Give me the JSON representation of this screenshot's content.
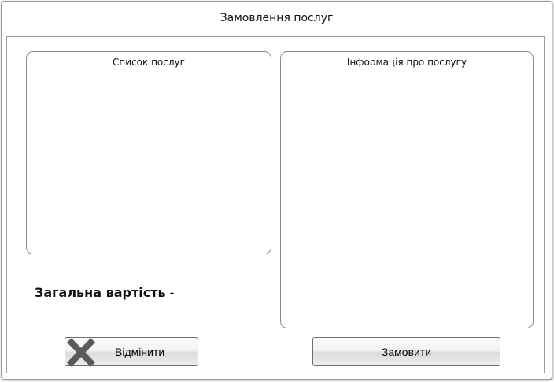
{
  "window": {
    "title": "Замовлення послуг"
  },
  "services_panel": {
    "title": "Список послуг"
  },
  "info_panel": {
    "title": "Інформація про послугу"
  },
  "total": {
    "label": "Загальна вартість",
    "value": " -"
  },
  "buttons": {
    "cancel_label": "Відмінити",
    "cancel_icon": "close-x-icon",
    "order_label": "Замовити"
  },
  "colors": {
    "border": "#9a9a9a",
    "icon": "#5a5a5a"
  }
}
